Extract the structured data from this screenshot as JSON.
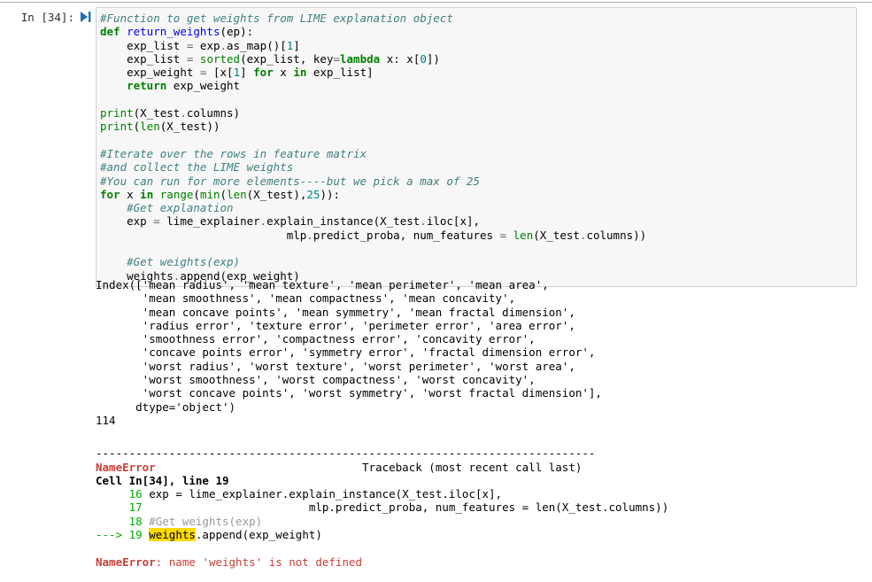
{
  "notebook": {
    "cell": {
      "prompt_label": "In [34]:",
      "run_icon": "run-cell-icon",
      "source_lines": [
        "#Function to get weights from LIME explanation object",
        "def return_weights(ep):",
        "    exp_list = exp.as_map()[1]",
        "    exp_list = sorted(exp_list, key=lambda x: x[0])",
        "    exp_weight = [x[1] for x in exp_list]",
        "    return exp_weight",
        "",
        "print(X_test.columns)",
        "print(len(X_test))",
        "",
        "#Iterate over the rows in feature matrix",
        "#and collect the LIME weights",
        "#You can run for more elements----but we pick a max of 25",
        "for x in range(min(len(X_test),25)):",
        "    #Get explanation",
        "    exp = lime_explainer.explain_instance(X_test.iloc[x],",
        "                            mlp.predict_proba, num_features = len(X_test.columns))",
        "    #Get weights(exp)",
        "    weights.append(exp_weight)"
      ]
    },
    "output": {
      "stdout_index": "Index(['mean radius', 'mean texture', 'mean perimeter', 'mean area',\n       'mean smoothness', 'mean compactness', 'mean concavity',\n       'mean concave points', 'mean symmetry', 'mean fractal dimension',\n       'radius error', 'texture error', 'perimeter error', 'area error',\n       'smoothness error', 'compactness error', 'concavity error',\n       'concave points error', 'symmetry error', 'fractal dimension error',\n       'worst radius', 'worst texture', 'worst perimeter', 'worst area',\n       'worst smoothness', 'worst compactness', 'worst concavity',\n       'worst concave points', 'worst symmetry', 'worst fractal dimension'],\n      dtype='object')",
      "stdout_count": "114",
      "traceback": {
        "separator": "---------------------------------------------------------------------------",
        "error_type": "NameError",
        "traceback_header": "Traceback (most recent call last)",
        "frame_title": "Cell In[34], line 19",
        "frames": [
          {
            "lineno": "     16 ",
            "text": "exp = lime_explainer.explain_instance(X_test.iloc[x],"
          },
          {
            "lineno": "     17 ",
            "text": "                        mlp.predict_proba, num_features = len(X_test.columns))"
          },
          {
            "lineno": "     18 ",
            "text": "#Get weights(exp)"
          }
        ],
        "arrow_prefix": "---> 19 ",
        "arrow_highlight": "weights",
        "arrow_rest": ".append(exp_weight)",
        "message_name": "NameError",
        "message_body": ": name 'weights' is not defined"
      }
    }
  },
  "colors": {
    "cell_background": "#f7f7f7",
    "cell_border": "#cfcfcf",
    "comment": "#408080",
    "keyword": "#008000",
    "function_name": "#0000ff",
    "builtin": "#008000",
    "number": "#008080",
    "error_red": "#cb3f38",
    "separator_red": "#b00000",
    "highlight_yellow": "#ffd900",
    "lineno_green": "#00aa00",
    "run_icon_blue": "#1f6fb5"
  }
}
